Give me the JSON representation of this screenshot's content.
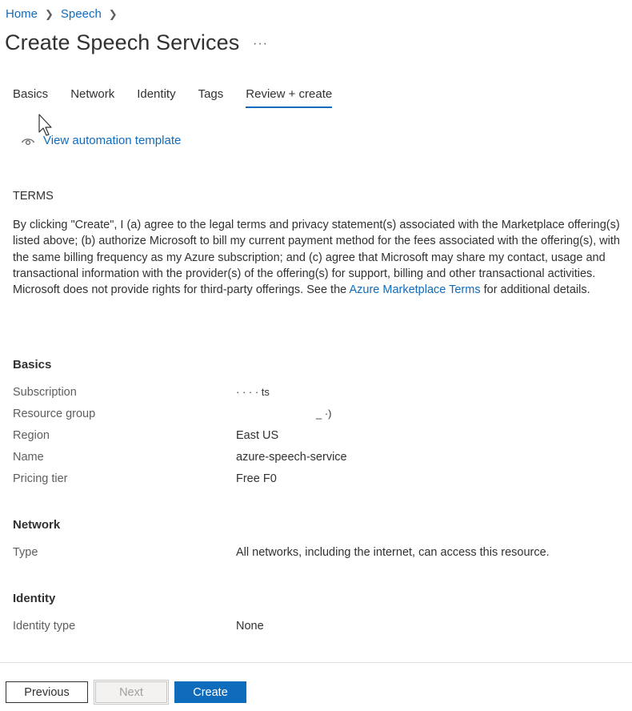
{
  "breadcrumb": {
    "home": "Home",
    "speech": "Speech"
  },
  "page": {
    "title": "Create Speech Services",
    "more": "···"
  },
  "tabs": [
    {
      "label": "Basics"
    },
    {
      "label": "Network"
    },
    {
      "label": "Identity"
    },
    {
      "label": "Tags"
    },
    {
      "label": "Review + create"
    }
  ],
  "automation": {
    "link": "View automation template"
  },
  "terms": {
    "heading": "TERMS",
    "text_before": "By clicking \"Create\", I (a) agree to the legal terms and privacy statement(s) associated with the Marketplace offering(s) listed above; (b) authorize Microsoft to bill my current payment method for the fees associated with the offering(s), with the same billing frequency as my Azure subscription; and (c) agree that Microsoft may share my contact, usage and transactional information with the provider(s) of the offering(s) for support, billing and other transactional activities. Microsoft does not provide rights for third-party offerings. See the ",
    "link": "Azure Marketplace Terms",
    "text_after": " for additional details."
  },
  "basics": {
    "heading": "Basics",
    "subscription_label": "Subscription",
    "subscription_value": "·  ·  ·  ·  ts",
    "resource_group_label": "Resource group",
    "resource_group_value": "_   ·)",
    "region_label": "Region",
    "region_value": "East US",
    "name_label": "Name",
    "name_value": "azure-speech-service",
    "pricing_label": "Pricing tier",
    "pricing_value": "Free F0"
  },
  "network": {
    "heading": "Network",
    "type_label": "Type",
    "type_value": "All networks, including the internet, can access this resource."
  },
  "identity": {
    "heading": "Identity",
    "type_label": "Identity type",
    "type_value": "None"
  },
  "footer": {
    "previous": "Previous",
    "next": "Next",
    "create": "Create"
  }
}
